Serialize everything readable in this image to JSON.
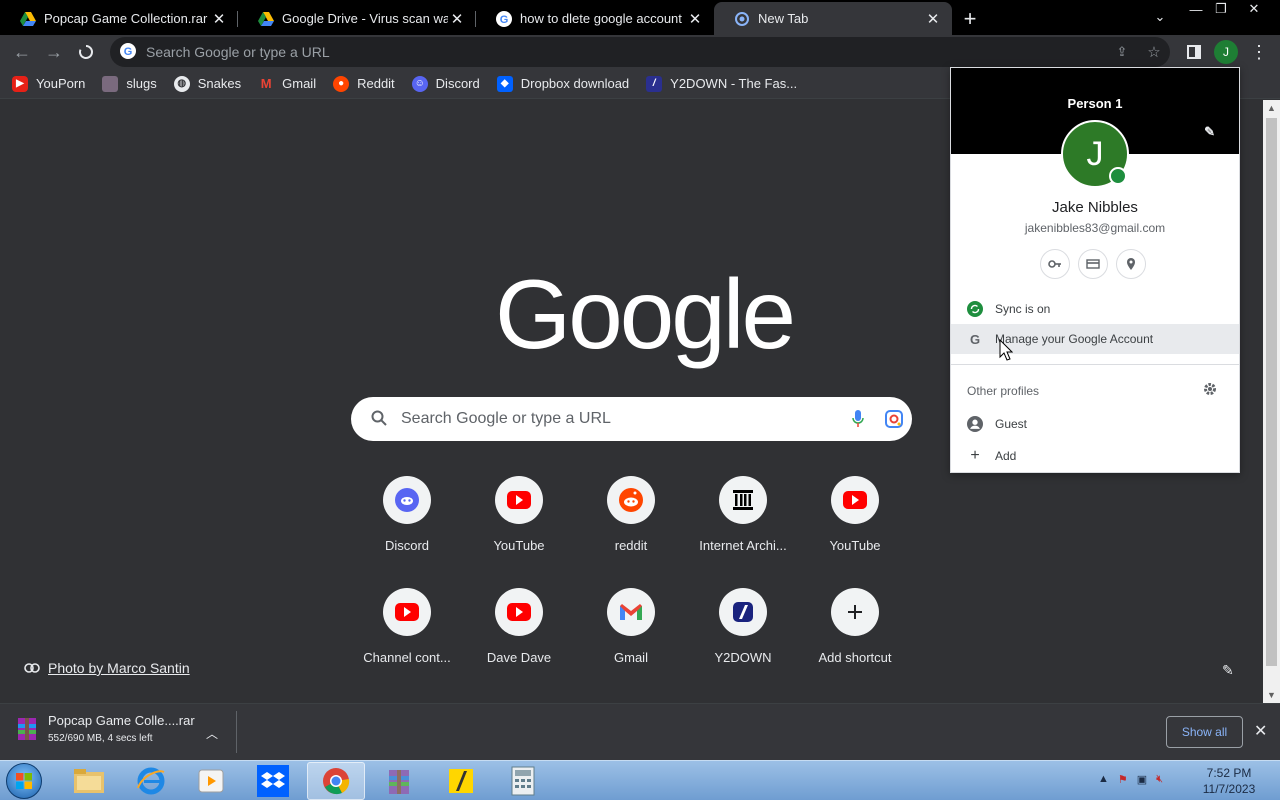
{
  "tabs": [
    {
      "title": "Popcap Game Collection.rar - Go",
      "icon": "google-drive-icon"
    },
    {
      "title": "Google Drive - Virus scan warnin",
      "icon": "google-drive-icon"
    },
    {
      "title": "how to dlete google account - G",
      "icon": "google-g-icon"
    },
    {
      "title": "New Tab",
      "icon": "chrome-icon"
    }
  ],
  "toolbar": {
    "omnibox_placeholder": "Search Google or type a URL",
    "profile_initial": "J"
  },
  "bookmarks": [
    {
      "label": "YouPorn",
      "color": "#e62117"
    },
    {
      "label": "slugs",
      "color": "#7a6a7e"
    },
    {
      "label": "Snakes",
      "color": "#e8eaed"
    },
    {
      "label": "Gmail",
      "color": "#ea4335"
    },
    {
      "label": "Reddit",
      "color": "#ff4500"
    },
    {
      "label": "Discord",
      "color": "#5865f2"
    },
    {
      "label": "Dropbox download",
      "color": "#0061ff"
    },
    {
      "label": "Y2DOWN - The Fas...",
      "color": "#2a2f8f"
    }
  ],
  "ntp": {
    "logo_text": "Google",
    "search_placeholder": "Search Google or type a URL",
    "shortcuts": [
      {
        "label": "Discord",
        "icon": "discord-icon"
      },
      {
        "label": "YouTube",
        "icon": "youtube-icon"
      },
      {
        "label": "reddit",
        "icon": "reddit-icon"
      },
      {
        "label": "Internet Archi...",
        "icon": "internet-archive-icon"
      },
      {
        "label": "YouTube",
        "icon": "youtube-icon"
      },
      {
        "label": "Channel cont...",
        "icon": "youtube-icon"
      },
      {
        "label": "Dave Dave",
        "icon": "youtube-icon"
      },
      {
        "label": "Gmail",
        "icon": "gmail-icon"
      },
      {
        "label": "Y2DOWN",
        "icon": "y2down-icon"
      },
      {
        "label": "Add shortcut",
        "icon": "plus-icon"
      }
    ],
    "attribution": "Photo by Marco Santin"
  },
  "profile_popup": {
    "header": "Person 1",
    "initial": "J",
    "name": "Jake Nibbles",
    "email": "jakenibbles83@gmail.com",
    "sync_label": "Sync is on",
    "manage_label": "Manage your Google Account",
    "other_profiles_label": "Other profiles",
    "guest_label": "Guest",
    "add_label": "Add"
  },
  "download": {
    "filename": "Popcap Game Colle....rar",
    "status": "552/690 MB, 4 secs left",
    "show_all": "Show all"
  },
  "taskbar": {
    "time": "7:52 PM",
    "date": "11/7/2023"
  }
}
